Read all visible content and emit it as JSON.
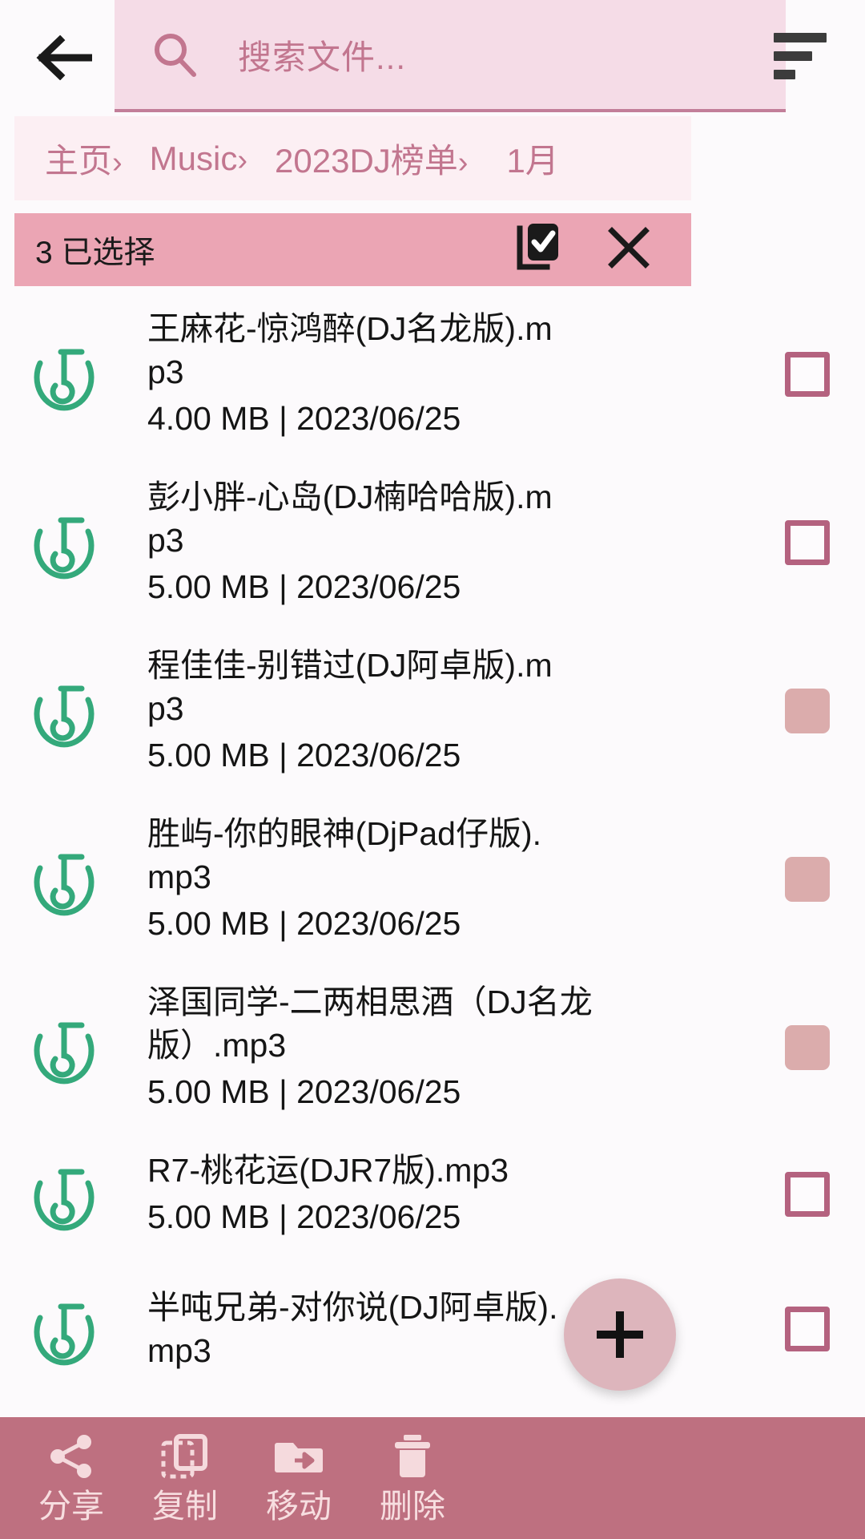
{
  "theme": {
    "page_bg": "#FCFAFC",
    "search_bg": "#F5DCE7",
    "accent_pink": "#C2768F",
    "breadcrumb_bg": "#FCEFF3",
    "selection_bar_bg": "#EBA5B4",
    "bottom_bar_bg": "#BE7080",
    "fab_bg": "#DDB5BC",
    "checkbox_border": "#B4627F",
    "checkbox_checked": "#DBACAC",
    "music_icon_green": "#34A97B",
    "text_primary": "#151515",
    "bottom_label": "#F7DEE0"
  },
  "topbar": {
    "back_icon": "arrow-left-icon",
    "search": {
      "icon": "search-icon",
      "placeholder": "搜索文件...",
      "value": ""
    },
    "sort_icon": "sort-lines-icon"
  },
  "breadcrumb": {
    "items": [
      {
        "label": "主页",
        "separator": "›"
      },
      {
        "label": "Music",
        "separator": "›"
      },
      {
        "label": "2023DJ榜单",
        "separator": "›"
      },
      {
        "label": "1月",
        "separator": ""
      }
    ]
  },
  "selection_bar": {
    "count_label": "3 已选择",
    "select_all_icon": "select-all-checkbox-icon",
    "close_icon": "close-x-icon"
  },
  "files": [
    {
      "icon": "music-note-icon",
      "name": "王麻花-惊鸿醉(DJ名龙版).mp3",
      "size": "4.00 MB",
      "date": "2023/06/25",
      "meta": "4.00 MB | 2023/06/25",
      "selected": false
    },
    {
      "icon": "music-note-icon",
      "name": "彭小胖-心岛(DJ楠哈哈版).mp3",
      "size": "5.00 MB",
      "date": "2023/06/25",
      "meta": "5.00 MB | 2023/06/25",
      "selected": false
    },
    {
      "icon": "music-note-icon",
      "name": "程佳佳-别错过(DJ阿卓版).mp3",
      "size": "5.00 MB",
      "date": "2023/06/25",
      "meta": "5.00 MB | 2023/06/25",
      "selected": true
    },
    {
      "icon": "music-note-icon",
      "name": "胜屿-你的眼神(DjPad仔版).mp3",
      "size": "5.00 MB",
      "date": "2023/06/25",
      "meta": "5.00 MB | 2023/06/25",
      "selected": true
    },
    {
      "icon": "music-note-icon",
      "name": "泽国同学-二两相思酒（DJ名龙版）.mp3",
      "size": "5.00 MB",
      "date": "2023/06/25",
      "meta": "5.00 MB | 2023/06/25",
      "selected": true
    },
    {
      "icon": "music-note-icon",
      "name": "R7-桃花运(DJR7版).mp3",
      "size": "5.00 MB",
      "date": "2023/06/25",
      "meta": "5.00 MB | 2023/06/25",
      "selected": false
    },
    {
      "icon": "music-note-icon",
      "name": "半吨兄弟-对你说(DJ阿卓版).mp3",
      "size": "",
      "date": "",
      "meta": "",
      "selected": false
    }
  ],
  "fab": {
    "icon": "plus-icon",
    "label": "+"
  },
  "bottom_toolbar": {
    "items": [
      {
        "label": "分享",
        "icon": "share-icon"
      },
      {
        "label": "复制",
        "icon": "copy-icon"
      },
      {
        "label": "移动",
        "icon": "move-folder-icon"
      },
      {
        "label": "删除",
        "icon": "trash-icon"
      }
    ]
  }
}
